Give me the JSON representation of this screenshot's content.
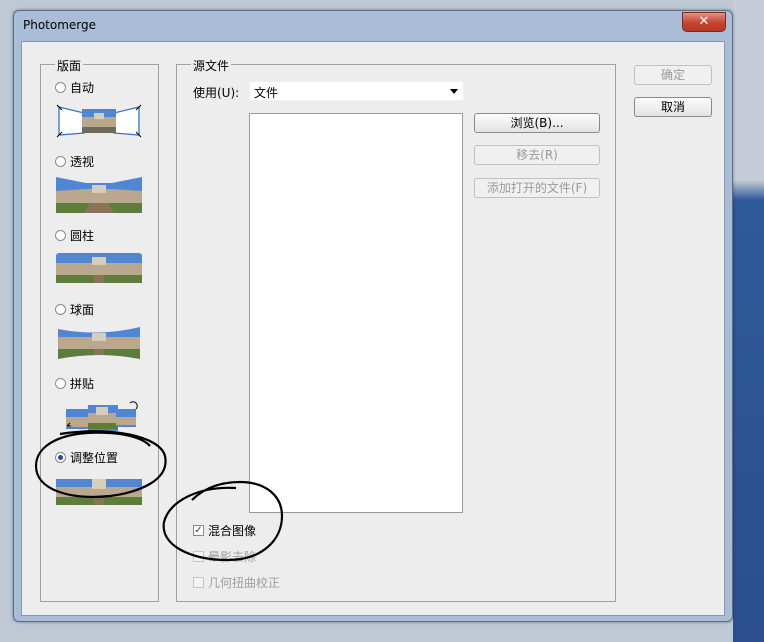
{
  "window": {
    "title": "Photomerge",
    "close_glyph": "✕"
  },
  "layout_group": {
    "legend": "版面",
    "options": [
      {
        "label": "自动",
        "selected": false
      },
      {
        "label": "透视",
        "selected": false
      },
      {
        "label": "圆柱",
        "selected": false
      },
      {
        "label": "球面",
        "selected": false
      },
      {
        "label": "拼贴",
        "selected": false
      },
      {
        "label": "调整位置",
        "selected": true
      }
    ]
  },
  "source_group": {
    "legend": "源文件",
    "use_label": "使用(U):",
    "use_value": "文件",
    "browse_label": "浏览(B)...",
    "remove_label": "移去(R)",
    "add_open_label": "添加打开的文件(F)",
    "files": []
  },
  "options": {
    "blend_images": {
      "label": "混合图像",
      "checked": true
    },
    "vignette_removal": {
      "label": "晕影去除",
      "checked": false,
      "enabled": false
    },
    "distortion_correction": {
      "label": "几何扭曲校正",
      "checked": false,
      "enabled": false
    }
  },
  "buttons": {
    "ok": "确定",
    "cancel": "取消"
  },
  "colors": {
    "sky": "#4f86d6",
    "building": "#b9a78e",
    "grass": "#5f7d3a",
    "annotation": "#000000"
  }
}
